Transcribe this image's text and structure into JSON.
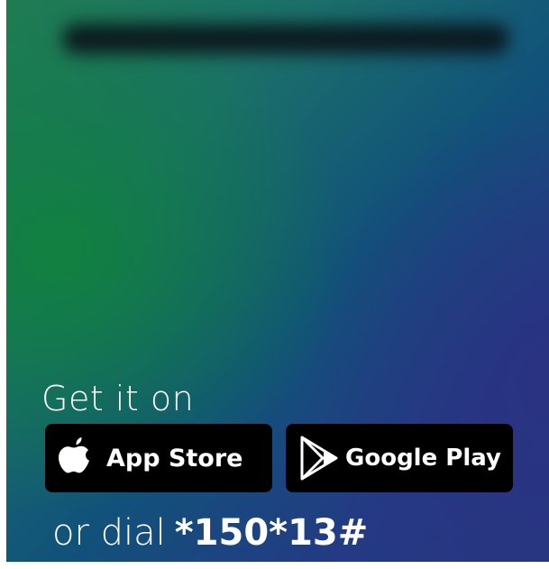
{
  "promo": {
    "get_it_on": "Get it on",
    "app_store_label": "App Store",
    "google_play_label": "Google Play",
    "dial_prefix": "or dial",
    "dial_code": "*150*13#"
  },
  "icons": {
    "app_store": "apple-logo-icon",
    "google_play": "google-play-logo-icon"
  },
  "colors": {
    "button_bg": "#000000",
    "text": "#ffffff",
    "gradient_green": "#10823c",
    "gradient_blue": "#243a84"
  }
}
